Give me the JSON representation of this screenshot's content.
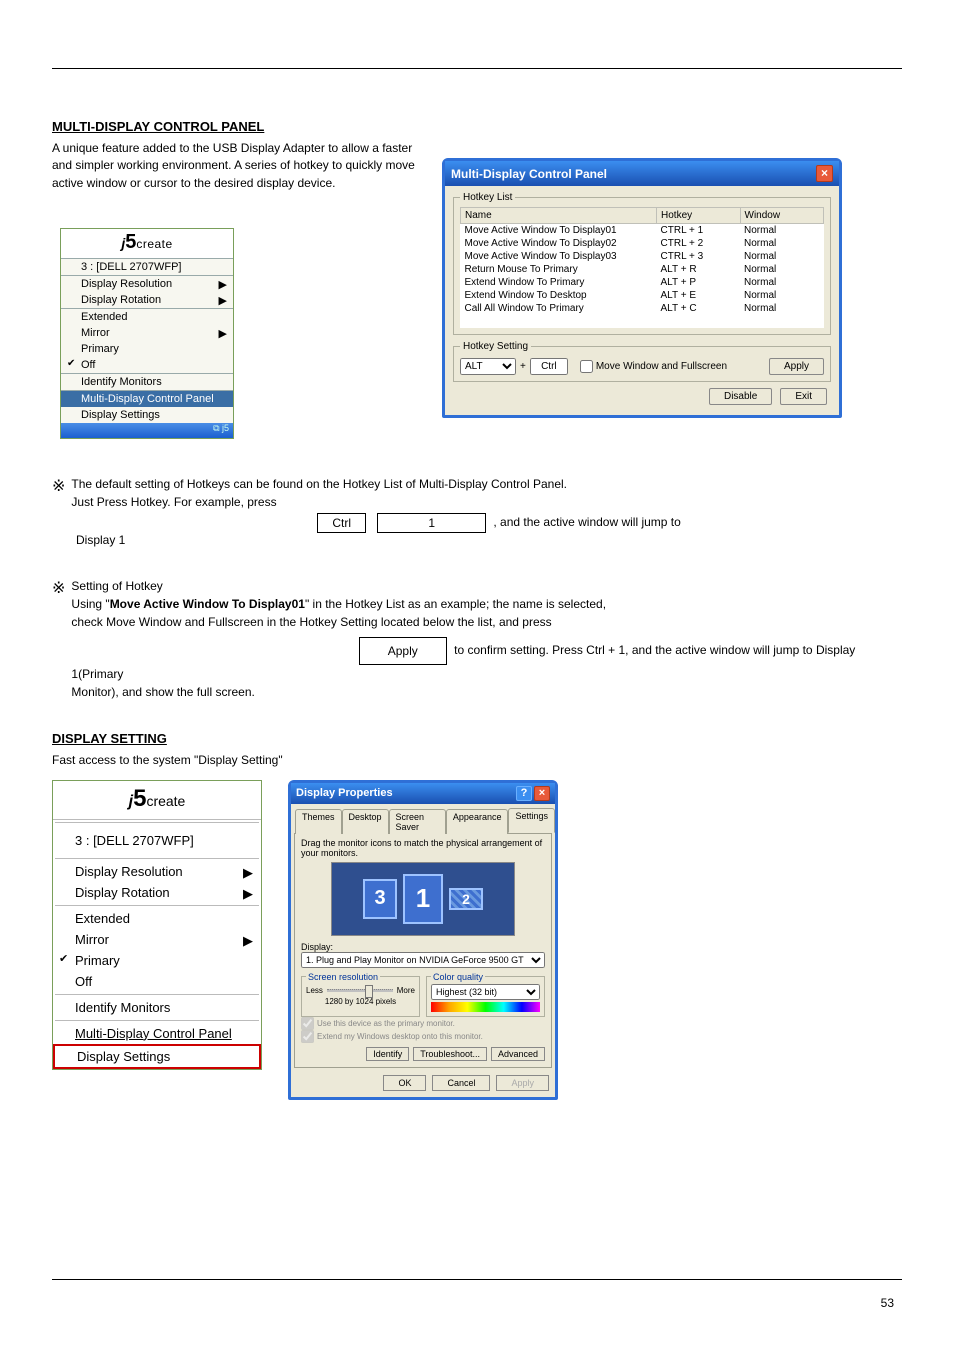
{
  "page_number": "53",
  "section1": {
    "title": "MULTI-DISPLAY CONTROL PANEL",
    "intro": "A unique feature added to the USB Display Adapter to allow a faster and simpler working environment. A series of hotkey to quickly move active window or cursor to the desired display device."
  },
  "note1": "The default setting of Hotkeys can be found on the Hotkey List of Multi-Display Control Panel.",
  "note1_line2_prefix": "Just Press Hotkey. For example, press ",
  "note1_key1": "Ctrl",
  "note1_key_plus": "+",
  "note1_key2": "1",
  "note1_line2_suffix": ", and the active window will jump to ",
  "note1_line3": "Display 1",
  "note2": "Setting of Hotkey",
  "note2_line1_prefix": "Using \"",
  "note2_line1_mid": "Move Active Window To Display01",
  "note2_line1_suffix": "\" in the Hotkey List as an example; the name is selected, ",
  "note2_line2": "check Move Window and Fullscreen in the Hotkey Setting located below the list, and press",
  "note2_apply": "Apply",
  "note2_line3": " to confirm setting. Press Ctrl + 1, and the active window will jump to Display 1(Primary ",
  "note2_line4": "Monitor), and show the full screen.",
  "section2": {
    "title": "DISPLAY SETTING",
    "intro": "Fast access to the system \"Display Setting\""
  },
  "traymenu": {
    "logo_brand": "j5create",
    "device": "3 : [DELL 2707WFP]",
    "items": {
      "resolution": "Display Resolution",
      "rotation": "Display Rotation",
      "extended": "Extended",
      "mirror": "Mirror",
      "primary": "Primary",
      "off": "Off",
      "identify": "Identify Monitors",
      "mdcp": "Multi-Display Control Panel",
      "settings": "Display Settings"
    }
  },
  "traymenu2": {
    "device": "3 : [DELL 2707WFP]",
    "items": {
      "resolution": "Display Resolution",
      "rotation": "Display Rotation",
      "extended": "Extended",
      "mirror": "Mirror",
      "primary": "Primary",
      "off": "Off",
      "identify": "Identify Monitors",
      "mdcp": "Multi-Display Control Panel",
      "settings": "Display Settings"
    }
  },
  "cpwin": {
    "title": "Multi-Display Control Panel",
    "hotkey_list_legend": "Hotkey List",
    "columns": {
      "name": "Name",
      "hotkey": "Hotkey",
      "window": "Window"
    },
    "rows": [
      {
        "name": "Move Active Window To Display01",
        "hotkey": "CTRL + 1",
        "window": "Normal"
      },
      {
        "name": "Move Active Window To Display02",
        "hotkey": "CTRL + 2",
        "window": "Normal"
      },
      {
        "name": "Move Active Window To Display03",
        "hotkey": "CTRL + 3",
        "window": "Normal"
      },
      {
        "name": "Return Mouse To Primary",
        "hotkey": "ALT + R",
        "window": "Normal"
      },
      {
        "name": "Extend Window To Primary",
        "hotkey": "ALT + P",
        "window": "Normal"
      },
      {
        "name": "Extend Window To Desktop",
        "hotkey": "ALT + E",
        "window": "Normal"
      },
      {
        "name": "Call All Window To Primary",
        "hotkey": "ALT + C",
        "window": "Normal"
      }
    ],
    "hotkey_setting_legend": "Hotkey Setting",
    "select_value": "ALT",
    "plus": "+",
    "ctrl_value": "Ctrl",
    "checkbox_label": "Move Window and Fullscreen",
    "apply": "Apply",
    "disable": "Disable",
    "exit": "Exit"
  },
  "dpwin": {
    "title": "Display Properties",
    "tabs": [
      "Themes",
      "Desktop",
      "Screen Saver",
      "Appearance",
      "Settings"
    ],
    "active_tab": "Settings",
    "instruction": "Drag the monitor icons to match the physical arrangement of your monitors.",
    "monitors": {
      "m1": "1",
      "m2": "2",
      "m3": "3"
    },
    "display_label": "Display:",
    "display_select": "1. Plug and Play Monitor on NVIDIA GeForce 9500 GT",
    "screen_res_legend": "Screen resolution",
    "less": "Less",
    "more": "More",
    "res_text": "1280 by 1024 pixels",
    "color_quality_legend": "Color quality",
    "color_select": "Highest (32 bit)",
    "chk1": "Use this device as the primary monitor.",
    "chk2": "Extend my Windows desktop onto this monitor.",
    "identify": "Identify",
    "troubleshoot": "Troubleshoot...",
    "advanced": "Advanced",
    "ok": "OK",
    "cancel": "Cancel",
    "apply": "Apply"
  }
}
